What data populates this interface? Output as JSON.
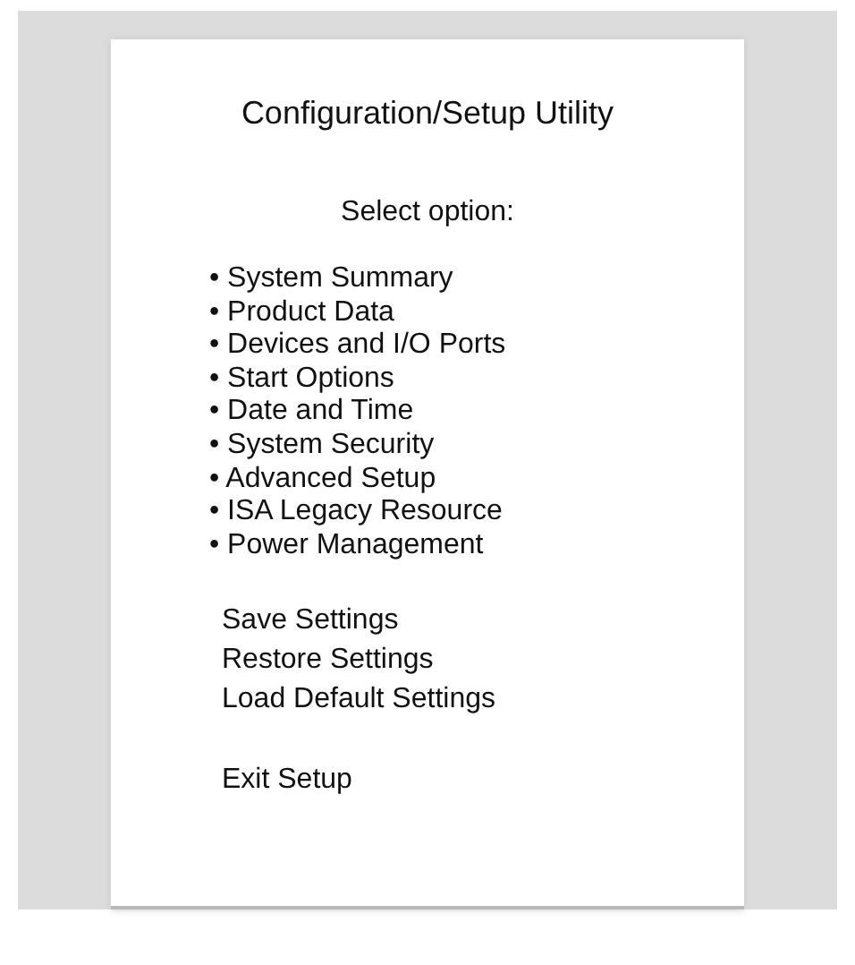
{
  "title": "Configuration/Setup Utility",
  "prompt": "Select option:",
  "menu_items": [
    {
      "label": "• System Summary"
    },
    {
      "label": "• Product Data"
    },
    {
      "label": "• Devices and I/O Ports"
    },
    {
      "label": "• Start Options"
    },
    {
      "label": "• Date and Time"
    },
    {
      "label": "• System Security"
    },
    {
      "label": "• Advanced Setup"
    },
    {
      "label": "• ISA Legacy Resource"
    },
    {
      "label": "• Power Management"
    }
  ],
  "settings_actions": [
    {
      "label": "Save Settings"
    },
    {
      "label": "Restore Settings"
    },
    {
      "label": "Load Default Settings"
    }
  ],
  "exit_action": {
    "label": "Exit Setup"
  }
}
